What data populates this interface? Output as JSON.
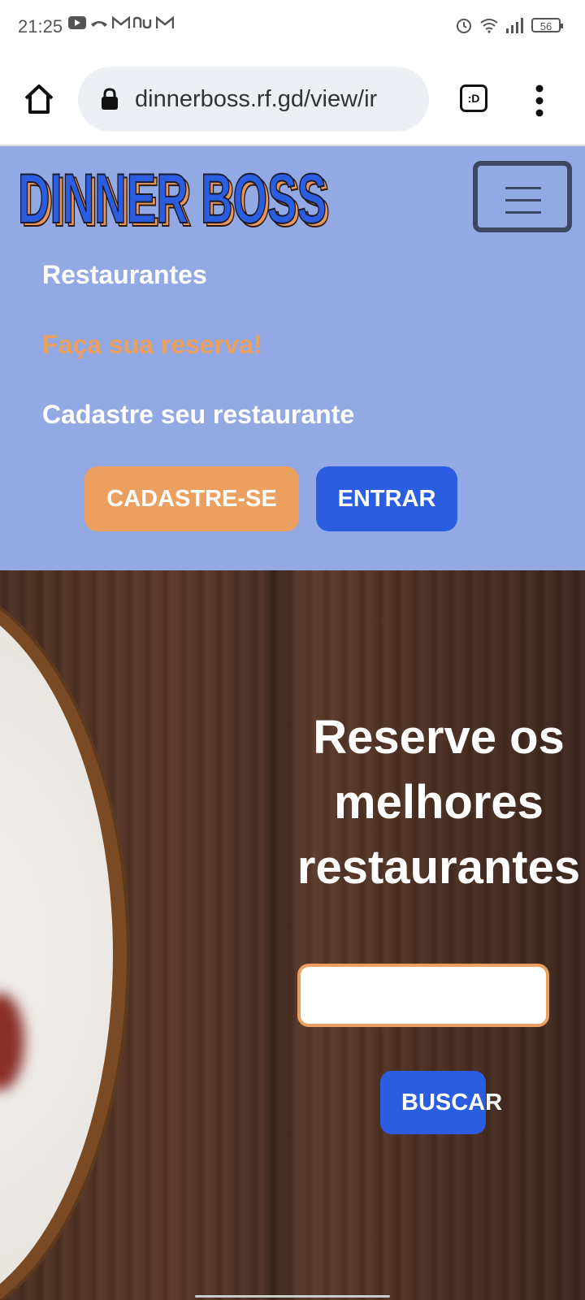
{
  "status_bar": {
    "time": "21:25",
    "left_icons": [
      "youtube-icon",
      "missed-call-icon",
      "gmail-icon",
      "nubank-icon",
      "gmail-icon"
    ],
    "right_icons": [
      "alarm-icon",
      "wifi-icon",
      "signal-icon"
    ],
    "battery": "56"
  },
  "browser": {
    "url": "dinnerboss.rf.gd/view/ir",
    "tabs_label": ":D"
  },
  "header": {
    "logo_text": "DINNER BOSS",
    "nav": [
      {
        "label": "Restaurantes"
      },
      {
        "label": "Faça sua reserva!"
      },
      {
        "label": "Cadastre seu restaurante"
      }
    ],
    "signup_label": "CADASTRE-SE",
    "login_label": "ENTRAR"
  },
  "hero": {
    "title_lines": [
      "Reserve os",
      "melhores",
      "restaurantes"
    ],
    "search_value": "",
    "search_button": "BUSCAR"
  },
  "colors": {
    "header_bg": "#92a9e4",
    "accent_orange": "#eba060",
    "accent_blue": "#2a5de0"
  }
}
